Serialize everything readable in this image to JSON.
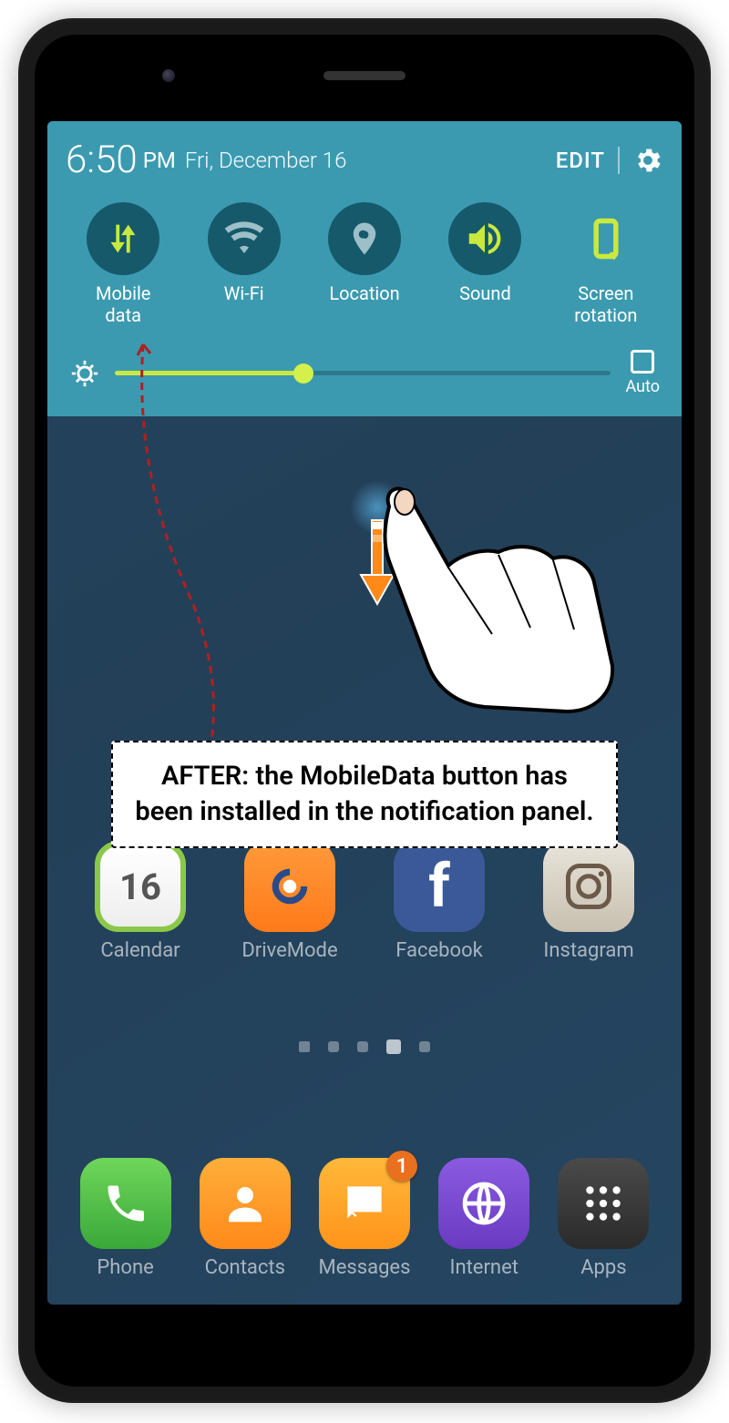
{
  "header": {
    "time": "6:50",
    "ampm": "PM",
    "date": "Fri, December 16",
    "edit_label": "EDIT"
  },
  "toggles": [
    {
      "label": "Mobile\ndata",
      "icon": "mobile-data-icon",
      "active": true
    },
    {
      "label": "Wi-Fi",
      "icon": "wifi-icon",
      "active": false
    },
    {
      "label": "Location",
      "icon": "location-icon",
      "active": false
    },
    {
      "label": "Sound",
      "icon": "sound-icon",
      "active": true
    },
    {
      "label": "Screen\nrotation",
      "icon": "rotation-icon",
      "active": true,
      "outline": true
    }
  ],
  "brightness": {
    "percent": 38,
    "auto_label": "Auto"
  },
  "home_apps_row1": [
    {
      "label": "Calendar",
      "icon": "calendar-icon",
      "day": "16"
    },
    {
      "label": "DriveMode",
      "icon": "drivemode-icon"
    },
    {
      "label": "Facebook",
      "icon": "facebook-icon"
    },
    {
      "label": "Instagram",
      "icon": "instagram-icon"
    }
  ],
  "dock_apps": [
    {
      "label": "Phone",
      "icon": "phone-icon"
    },
    {
      "label": "Contacts",
      "icon": "contacts-icon"
    },
    {
      "label": "Messages",
      "icon": "messages-icon",
      "badge": "1"
    },
    {
      "label": "Internet",
      "icon": "internet-icon"
    },
    {
      "label": "Apps",
      "icon": "apps-icon"
    }
  ],
  "callout_text": "AFTER: the MobileData button has been installed in the notification panel.",
  "colors": {
    "panel": "#3b9ab0",
    "toggle_bg": "#15596b",
    "accent_lime": "#c9e93e"
  }
}
